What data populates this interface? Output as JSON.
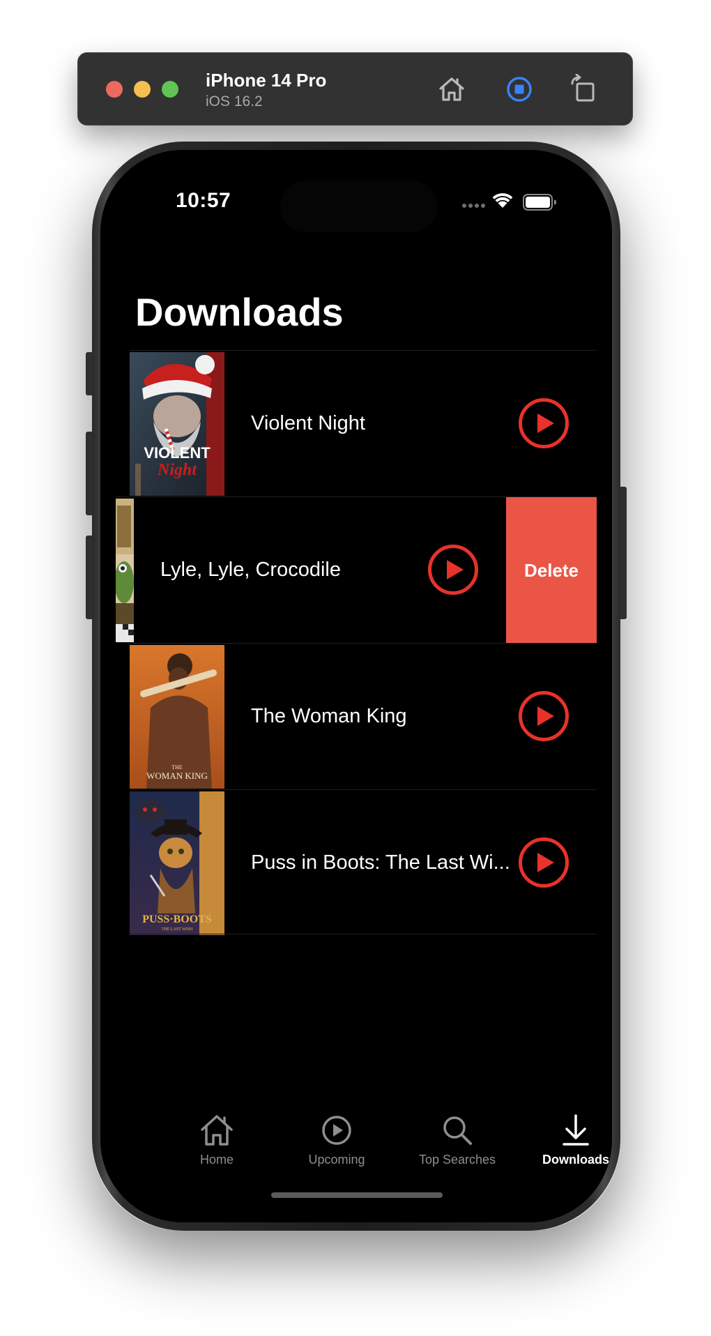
{
  "simulator": {
    "device_name": "iPhone 14 Pro",
    "os_version": "iOS 16.2"
  },
  "status_bar": {
    "time": "10:57"
  },
  "screen": {
    "title": "Downloads"
  },
  "downloads": [
    {
      "title": "Violent Night",
      "poster": "violent-night-poster"
    },
    {
      "title": "Lyle, Lyle, Crocodile",
      "poster": "lyle-lyle-crocodile-poster",
      "swipe_action": "Delete"
    },
    {
      "title": "The Woman King",
      "poster": "the-woman-king-poster"
    },
    {
      "title": "Puss in Boots: The Last Wish",
      "display_title": "Puss in Boots: The Last Wi...",
      "poster": "puss-in-boots-poster"
    }
  ],
  "tab_bar": {
    "tabs": [
      {
        "label": "Home",
        "icon": "house-icon"
      },
      {
        "label": "Upcoming",
        "icon": "play-circle-icon"
      },
      {
        "label": "Top Searches",
        "icon": "magnifyingglass-icon"
      },
      {
        "label": "Downloads",
        "icon": "arrow-down-to-line-icon",
        "active": true
      }
    ]
  },
  "colors": {
    "accent_red": "#e8322a",
    "delete_red": "#eb5545",
    "background": "#000000",
    "inactive_tab": "#8e8e93"
  }
}
